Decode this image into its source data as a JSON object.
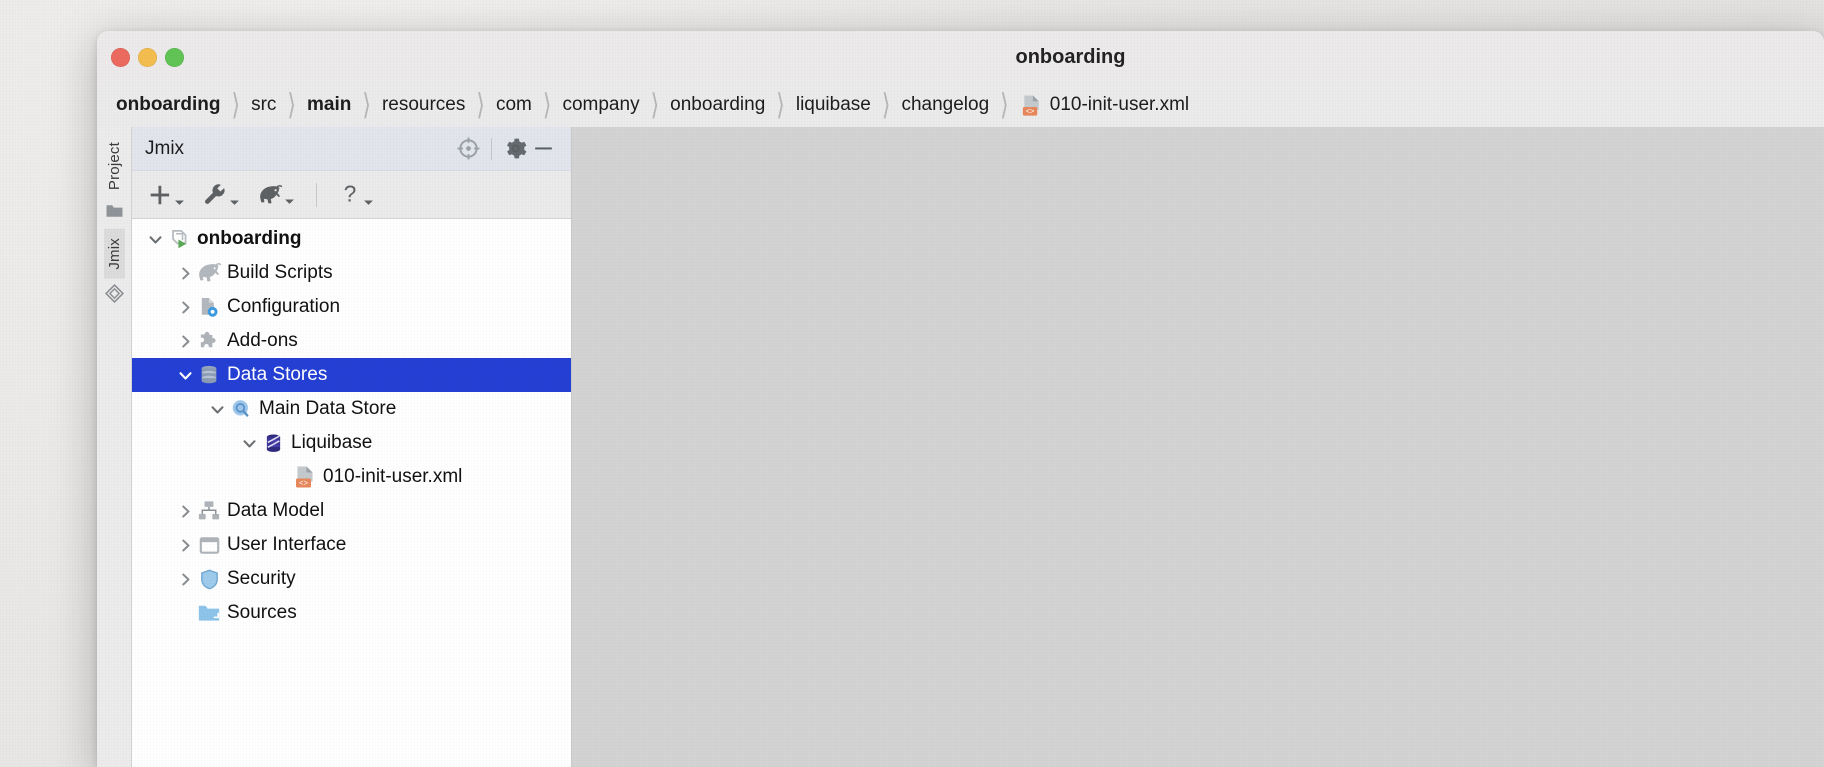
{
  "window": {
    "title": "onboarding",
    "traffic_lights": [
      "close-red",
      "minimize-yellow",
      "maximize-green"
    ],
    "colors": {
      "red": "#ec6a5f",
      "yellow": "#f4bd4f",
      "green": "#61c455",
      "selection": "#2440d4"
    }
  },
  "breadcrumb": {
    "separator": "〉",
    "items": [
      {
        "label": "onboarding",
        "bold": true
      },
      {
        "label": "src",
        "bold": false
      },
      {
        "label": "main",
        "bold": true
      },
      {
        "label": "resources",
        "bold": false
      },
      {
        "label": "com",
        "bold": false
      },
      {
        "label": "company",
        "bold": false
      },
      {
        "label": "onboarding",
        "bold": false
      },
      {
        "label": "liquibase",
        "bold": false
      },
      {
        "label": "changelog",
        "bold": false
      },
      {
        "label": "010-init-user.xml",
        "bold": false,
        "icon": "xml-file-icon"
      }
    ]
  },
  "tool_strip": {
    "tabs": [
      {
        "label": "Project",
        "icon": "folder-icon",
        "active": false
      },
      {
        "label": "Jmix",
        "icon": "jmix-diamond-icon",
        "active": true
      }
    ]
  },
  "tool_window": {
    "title": "Jmix",
    "header_buttons": [
      {
        "name": "locate-icon",
        "tooltip": "Select Opened File"
      },
      {
        "name": "gear-icon",
        "tooltip": "Options"
      },
      {
        "name": "minimize-icon",
        "tooltip": "Hide"
      }
    ],
    "toolbar_buttons": [
      {
        "name": "add-icon",
        "glyph": "+",
        "has_dropdown": true
      },
      {
        "name": "wrench-icon",
        "glyph": "wrench",
        "has_dropdown": true
      },
      {
        "name": "gradle-elephant-icon",
        "glyph": "elephant",
        "has_dropdown": true
      },
      {
        "name": "help-icon",
        "glyph": "?",
        "has_dropdown": true
      }
    ]
  },
  "tree": {
    "items": [
      {
        "label": "onboarding",
        "depth": 0,
        "twisty": "down",
        "icon": "jmix-project-icon",
        "bold": true,
        "selected": false
      },
      {
        "label": "Build Scripts",
        "depth": 1,
        "twisty": "right",
        "icon": "gradle-elephant-icon",
        "bold": false,
        "selected": false
      },
      {
        "label": "Configuration",
        "depth": 1,
        "twisty": "right",
        "icon": "configuration-icon",
        "bold": false,
        "selected": false
      },
      {
        "label": "Add-ons",
        "depth": 1,
        "twisty": "right",
        "icon": "puzzle-icon",
        "bold": false,
        "selected": false
      },
      {
        "label": "Data Stores",
        "depth": 1,
        "twisty": "down",
        "icon": "database-icon",
        "bold": false,
        "selected": true
      },
      {
        "label": "Main Data Store",
        "depth": 2,
        "twisty": "down",
        "icon": "data-store-icon",
        "bold": false,
        "selected": false
      },
      {
        "label": "Liquibase",
        "depth": 3,
        "twisty": "down",
        "icon": "liquibase-icon",
        "bold": false,
        "selected": false
      },
      {
        "label": "010-init-user.xml",
        "depth": 4,
        "twisty": "none",
        "icon": "xml-file-icon",
        "bold": false,
        "selected": false
      },
      {
        "label": "Data Model",
        "depth": 1,
        "twisty": "right",
        "icon": "data-model-icon",
        "bold": false,
        "selected": false
      },
      {
        "label": "User Interface",
        "depth": 1,
        "twisty": "right",
        "icon": "window-icon",
        "bold": false,
        "selected": false
      },
      {
        "label": "Security",
        "depth": 1,
        "twisty": "right",
        "icon": "shield-icon",
        "bold": false,
        "selected": false
      },
      {
        "label": "Sources",
        "depth": 1,
        "twisty": "none",
        "icon": "folder-icon",
        "bold": false,
        "selected": false
      }
    ]
  }
}
